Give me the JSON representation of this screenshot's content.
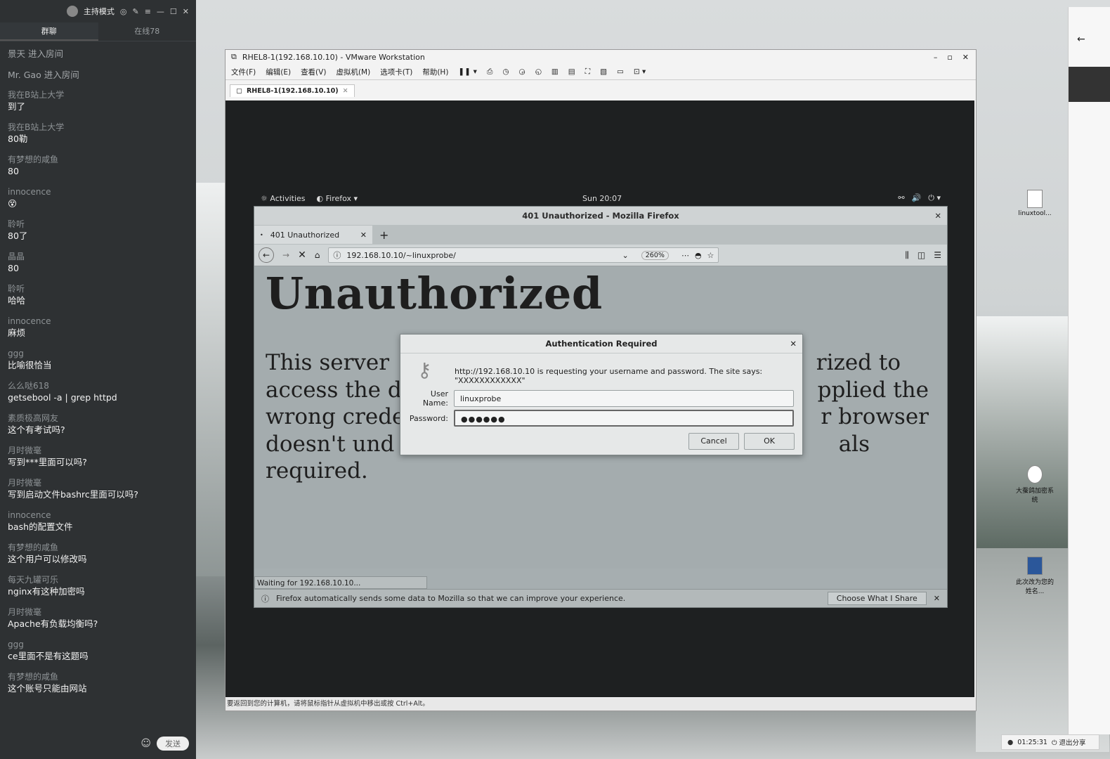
{
  "chat": {
    "host_mode": "主持模式",
    "tabs": [
      "群聊",
      "在线78"
    ],
    "system_messages": [
      "景天 进入房间",
      "Mr. Gao 进入房间"
    ],
    "messages": [
      {
        "user": "我在B站上大学",
        "text": "到了"
      },
      {
        "user": "我在B站上大学",
        "text": "80勒"
      },
      {
        "user": "有梦想的咸鱼",
        "text": "80"
      },
      {
        "user": "innocence",
        "text": "😵"
      },
      {
        "user": "聆听",
        "text": "80了"
      },
      {
        "user": "晶晶",
        "text": "80"
      },
      {
        "user": "聆听",
        "text": "哈哈"
      },
      {
        "user": "innocence",
        "text": "麻烦"
      },
      {
        "user": "ggg",
        "text": "比喻很恰当"
      },
      {
        "user": "么么哒618",
        "text": "getsebool -a | grep httpd"
      },
      {
        "user": "素质极高网友",
        "text": "这个有考试吗?"
      },
      {
        "user": "月时微毫",
        "text": "写到***里面可以吗?"
      },
      {
        "user": "月时微毫",
        "text": "写到启动文件bashrc里面可以吗?"
      },
      {
        "user": "innocence",
        "text": "bash的配置文件"
      },
      {
        "user": "有梦想的咸鱼",
        "text": "这个用户可以修改吗"
      },
      {
        "user": "每天九罐可乐",
        "text": "nginx有这种加密吗"
      },
      {
        "user": "月时微毫",
        "text": "Apache有负载均衡吗?"
      },
      {
        "user": "ggg",
        "text": "ce里面不是有这题吗"
      },
      {
        "user": "有梦想的咸鱼",
        "text": "这个账号只能由网站"
      }
    ],
    "send_label": "发送"
  },
  "vmware": {
    "title": "RHEL8-1(192.168.10.10) - VMware Workstation",
    "menu": [
      "文件(F)",
      "编辑(E)",
      "查看(V)",
      "虚拟机(M)",
      "选项卡(T)",
      "帮助(H)"
    ],
    "tab_label": "RHEL8-1(192.168.10.10)",
    "status": "要返回到您的计算机，请将鼠标指针从虚拟机中移出或按 Ctrl+Alt。"
  },
  "gnome": {
    "activities": "Activities",
    "app": "Firefox ▾",
    "clock": "Sun 20:07"
  },
  "firefox": {
    "window_title": "401 Unauthorized - Mozilla Firefox",
    "tab_title": "401 Unauthorized",
    "url": "192.168.10.10/~linuxprobe/",
    "zoom": "260%",
    "heading": "Unauthorized",
    "para_lines": [
      "This server",
      "access the d",
      "wrong crede",
      "doesn't und",
      "required."
    ],
    "para_right": [
      "rized to",
      "pplied the",
      "r browser",
      "als"
    ],
    "waiting": "Waiting for 192.168.10.10...",
    "notice": "Firefox automatically sends some data to Mozilla so that we can improve your experience.",
    "choose_label": "Choose What I Share"
  },
  "auth": {
    "title": "Authentication Required",
    "message": "http://192.168.10.10 is requesting your username and password. The site says: \"XXXXXXXXXXXX\"",
    "user_label": "User Name:",
    "user_value": "linuxprobe",
    "pass_label": "Password:",
    "pass_value": "●●●●●●",
    "cancel": "Cancel",
    "ok": "OK"
  },
  "desktop": {
    "icon1": "linuxtool...",
    "icon2": "大蚕鸽加密系统",
    "icon3": "此次改为您的姓名..."
  },
  "tray": {
    "time": "01:25:31",
    "exit_share": "退出分享"
  }
}
